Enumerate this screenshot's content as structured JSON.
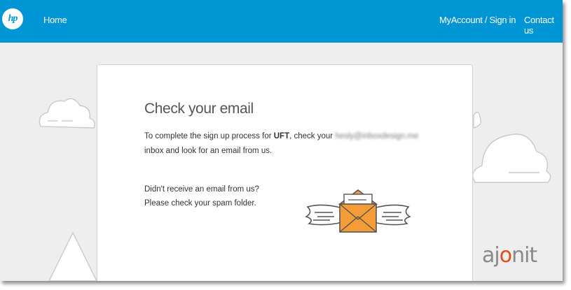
{
  "header": {
    "logo_text": "hp",
    "nav": {
      "home": "Home",
      "account": "MyAccount / Sign in",
      "contact": "Contact us"
    }
  },
  "card": {
    "title": "Check your email",
    "body_prefix": "To complete the sign up process for ",
    "product": "UFT",
    "body_mid": ", check your ",
    "email": "hesly@inboxdesign.me",
    "body_suffix": " inbox and look for an email from us.",
    "help_line1": "Didn't receive an email from us?",
    "help_line2": "Please check your spam folder."
  },
  "watermark": {
    "text_a": "aj",
    "text_b": "o",
    "text_c": "nit"
  },
  "colors": {
    "header": "#0096d6",
    "envelope": "#f39c38",
    "background": "#eeeeee"
  },
  "icons": {
    "logo": "hp-logo-icon",
    "envelope": "winged-envelope-icon"
  }
}
